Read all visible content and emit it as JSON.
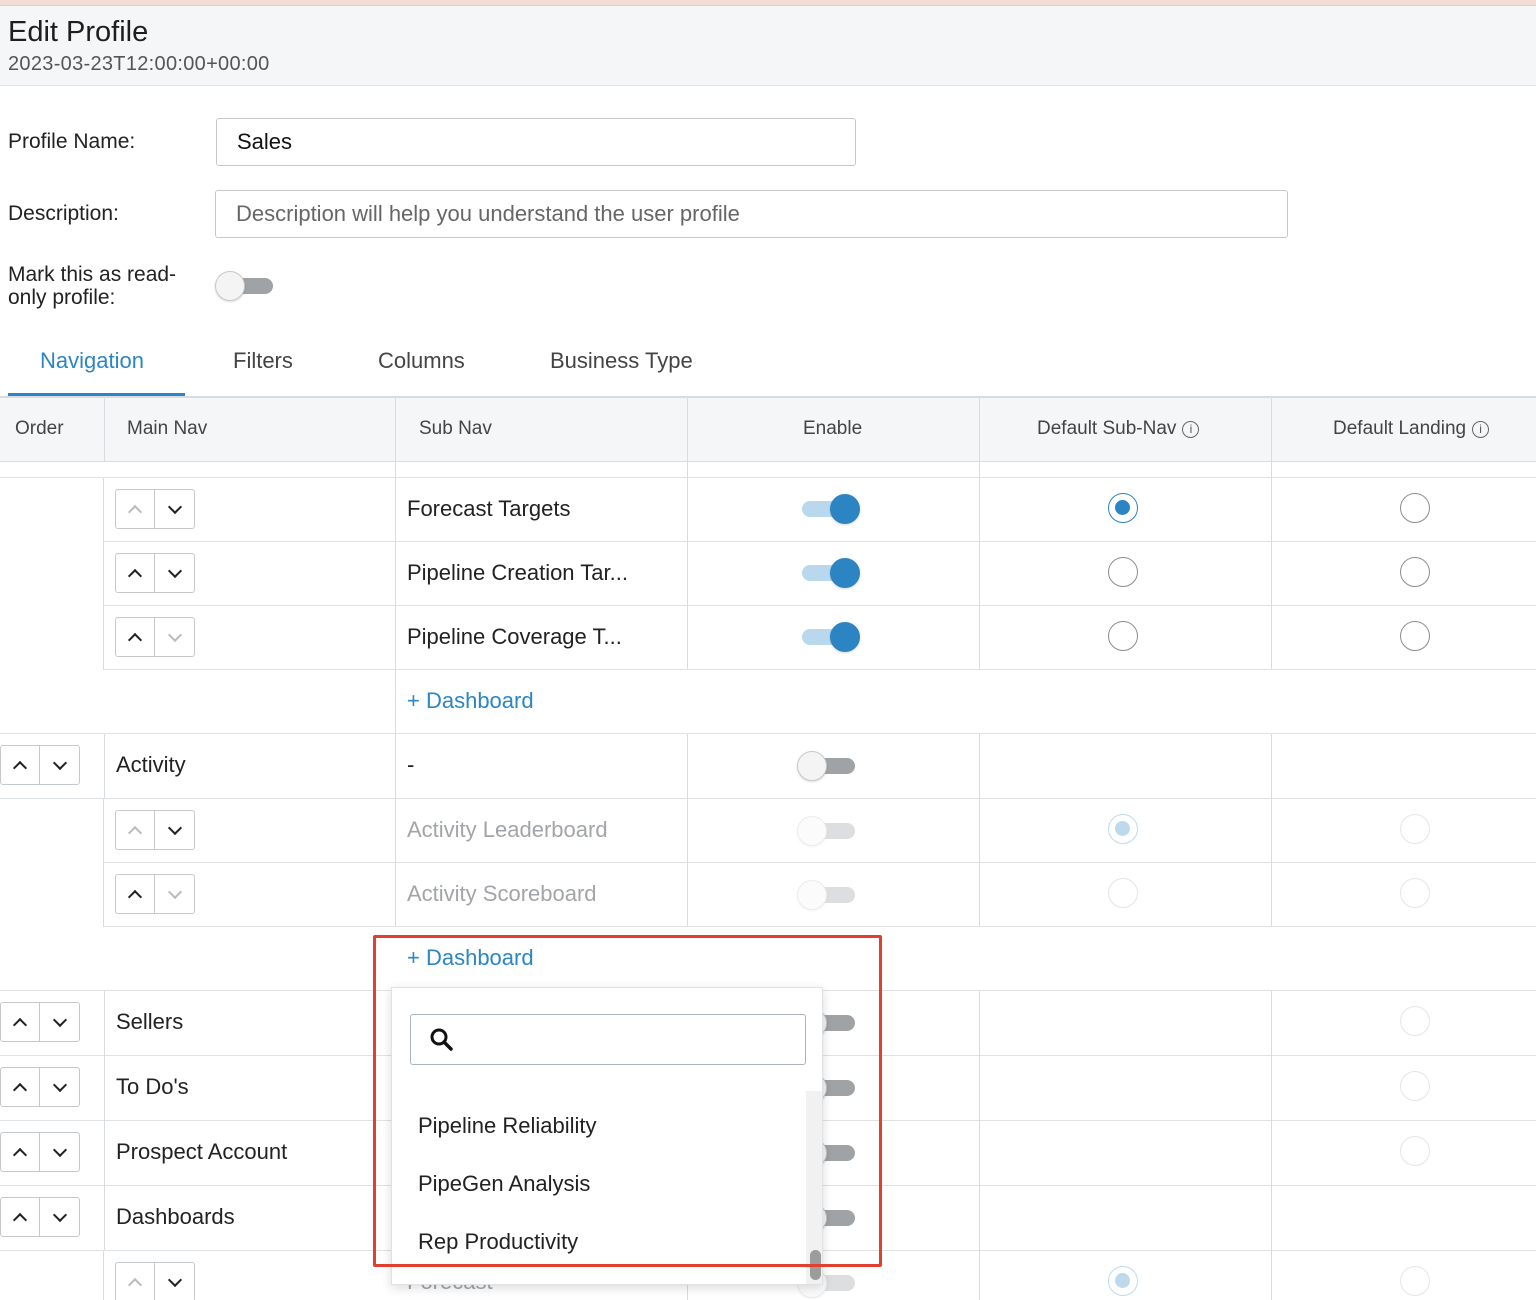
{
  "header": {
    "title": "Edit Profile",
    "timestamp": "2023-03-23T12:00:00+00:00"
  },
  "form": {
    "profile_name_label": "Profile Name:",
    "profile_name_value": "Sales",
    "description_label": "Description:",
    "description_placeholder": "Description will help you understand the user profile",
    "readonly_label_line1": "Mark this as read-",
    "readonly_label_line2": "only profile:",
    "readonly_enabled": false
  },
  "tabs": [
    {
      "label": "Navigation",
      "active": true
    },
    {
      "label": "Filters",
      "active": false
    },
    {
      "label": "Columns",
      "active": false
    },
    {
      "label": "Business Type",
      "active": false
    }
  ],
  "table": {
    "columns": [
      "Order",
      "Main Nav",
      "Sub Nav",
      "Enable",
      "Default Sub-Nav",
      "Default Landing"
    ],
    "forecast_subnav": [
      {
        "label": "Forecast Targets",
        "enabled": true,
        "default_sub_nav": true,
        "default_landing": false
      },
      {
        "label": "Pipeline Creation Tar...",
        "enabled": true,
        "default_sub_nav": false,
        "default_landing": false
      },
      {
        "label": "Pipeline Coverage T...",
        "enabled": true,
        "default_sub_nav": false,
        "default_landing": false
      }
    ],
    "add_dashboard_label": "+ Dashboard",
    "activity": {
      "main_nav": "Activity",
      "sub_nav": "-",
      "enabled": false,
      "subnav": [
        {
          "label": "Activity Leaderboard",
          "enabled": false,
          "default_sub_nav": true
        },
        {
          "label": "Activity Scoreboard",
          "enabled": false,
          "default_sub_nav": false
        }
      ]
    },
    "other_main_navs": [
      {
        "label": "Sellers"
      },
      {
        "label": "To Do's"
      },
      {
        "label": "Prospect Account"
      },
      {
        "label": "Dashboards"
      }
    ],
    "dashboards_subnav_partial": "Forecast"
  },
  "dropdown": {
    "search_value": "",
    "items": [
      "Pipeline Reliability",
      "PipeGen Analysis",
      "Rep Productivity"
    ]
  },
  "colors": {
    "accent": "#2b86c5",
    "highlight": "#e0412f"
  }
}
